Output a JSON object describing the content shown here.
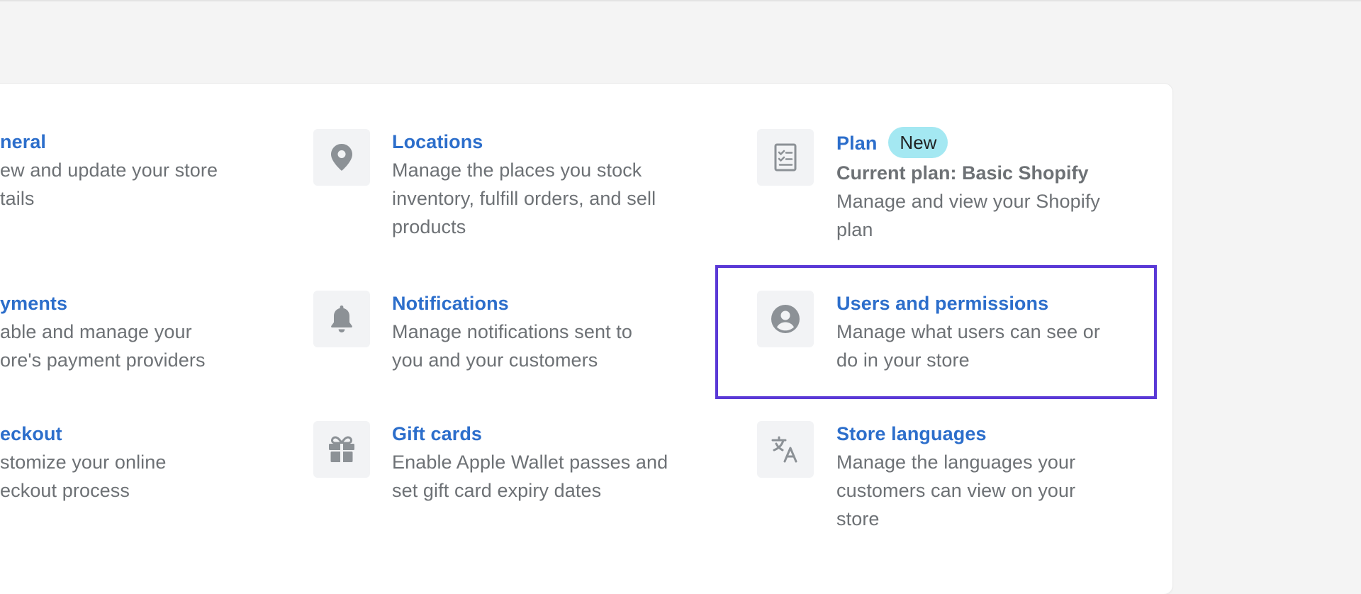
{
  "settings": {
    "items": [
      {
        "key": "general",
        "title": "neral",
        "description": "ew and update your store tails",
        "desc_lines": [
          "ew and update your store",
          "tails"
        ],
        "icon": "store-icon"
      },
      {
        "key": "payments",
        "title": "yments",
        "desc_lines": [
          "able and manage your",
          "ore's payment providers"
        ],
        "icon": "payment-icon"
      },
      {
        "key": "checkout",
        "title": "eckout",
        "desc_lines": [
          "stomize your online",
          "eckout process"
        ],
        "icon": "cart-icon"
      },
      {
        "key": "locations",
        "title": "Locations",
        "desc_lines": [
          "Manage the places you stock",
          "inventory, fulfill orders, and sell",
          "products"
        ],
        "icon": "location-pin-icon"
      },
      {
        "key": "notifications",
        "title": "Notifications",
        "desc_lines": [
          "Manage notifications sent to",
          "you and your customers"
        ],
        "icon": "bell-icon"
      },
      {
        "key": "gift_cards",
        "title": "Gift cards",
        "desc_lines": [
          "Enable Apple Wallet passes and",
          "set gift card expiry dates"
        ],
        "icon": "gift-icon"
      },
      {
        "key": "plan",
        "title": "Plan",
        "badge": "New",
        "subtitle": "Current plan: Basic Shopify",
        "desc_lines": [
          "Manage and view your Shopify",
          "plan"
        ],
        "icon": "checklist-icon"
      },
      {
        "key": "users",
        "title": "Users and permissions",
        "desc_lines": [
          "Manage what users can see or",
          "do in your store"
        ],
        "icon": "user-circle-icon"
      },
      {
        "key": "languages",
        "title": "Store languages",
        "desc_lines": [
          "Manage the languages your",
          "customers can view on your",
          "store"
        ],
        "icon": "translate-icon"
      }
    ]
  },
  "colors": {
    "title": "#2c6ecb",
    "description": "#6d7175",
    "badge_bg": "#a4e8f2",
    "highlight": "#5a39d6",
    "icon_bg": "#f2f3f5",
    "icon_fg": "#8c9196"
  }
}
